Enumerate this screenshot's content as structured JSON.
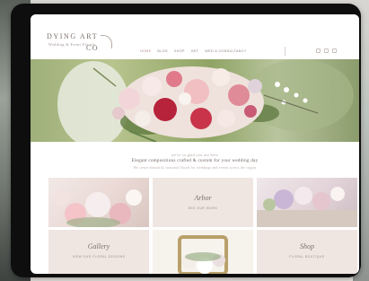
{
  "brand": {
    "name": "DYING ART",
    "co": "CO",
    "tagline": "Wedding & Event Florals"
  },
  "nav": {
    "items": [
      "HOME",
      "BLOG",
      "SHOP",
      "GET",
      "WED & CONSULTANCY"
    ]
  },
  "intro": {
    "small": "we're so glad you are here",
    "main": "Elegant compositions crafted & custom for your wedding day",
    "body": "We create beautiful, seasonal florals for weddings and events across the region"
  },
  "tiles": {
    "about": {
      "label": "Arbor",
      "sub": "SEE OUR WORK"
    },
    "gallery": {
      "label": "Gallery",
      "sub": "VIEW OUR FLORAL DESIGNS"
    },
    "shop": {
      "label": "Shop",
      "sub": "FLORAL BOUTIQUE"
    }
  },
  "colors": {
    "panel": "#efe6e1",
    "accent": "#b28a8a"
  }
}
